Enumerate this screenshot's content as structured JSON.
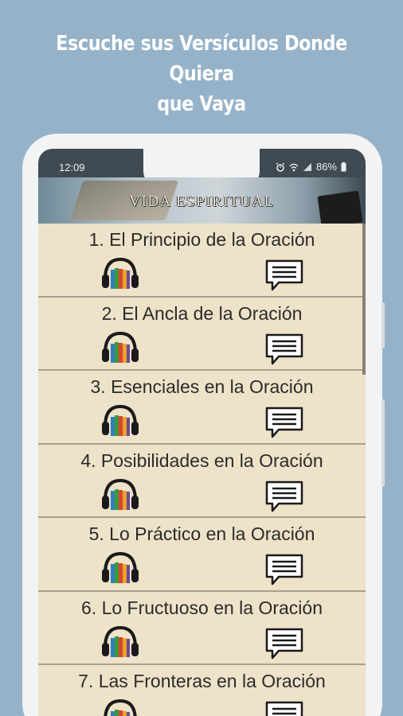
{
  "headline": {
    "line1": "Escuche sus Versículos Donde Quiera",
    "line2": "que Vaya"
  },
  "statusbar": {
    "time": "12:09",
    "battery": "86%",
    "icons": [
      "alarm-icon",
      "wifi-icon",
      "signal-icon",
      "battery-icon"
    ]
  },
  "banner": {
    "title": "VIDA ESPIRITUAL"
  },
  "items": [
    {
      "label": "1. El Principio de la Oración"
    },
    {
      "label": "2. El Ancla de la Oración"
    },
    {
      "label": "3. Esenciales en la Oración"
    },
    {
      "label": "4. Posibilidades en la Oración"
    },
    {
      "label": "5. Lo Práctico en la Oración"
    },
    {
      "label": "6. Lo Fructuoso en la Oración"
    },
    {
      "label": "7. Las Fronteras en la Oración"
    }
  ],
  "colors": {
    "background": "#95b2c8",
    "list_background": "#eee2c9",
    "status_bar": "#3f4a52"
  }
}
